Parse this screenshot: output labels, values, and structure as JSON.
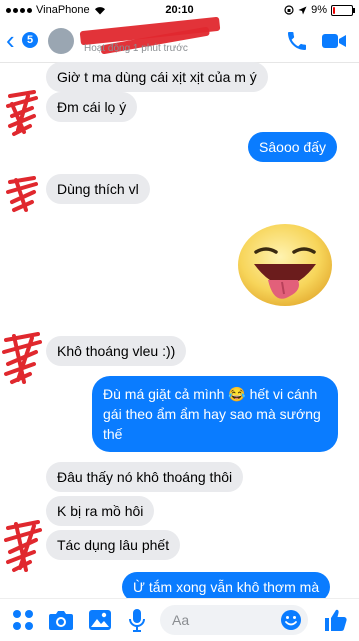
{
  "status_bar": {
    "carrier": "VinaPhone",
    "time": "20:10",
    "battery": "9%",
    "battery_level": 0.09
  },
  "header": {
    "back_count": "5",
    "status": "Hoạt động 1 phút trước"
  },
  "messages": [
    {
      "side": "in",
      "text": "Giờ t ma dùng cái xịt xịt của m ý"
    },
    {
      "side": "in",
      "text": "Đm cái lọ ý"
    },
    {
      "side": "out",
      "text": "Sâooo đấy"
    },
    {
      "side": "in",
      "text": "Dùng thích vl"
    },
    {
      "side": "out",
      "type": "sticker",
      "icon": "tongue-out-smiley-sticker"
    },
    {
      "side": "in",
      "text": "Khô thoáng vleu :))"
    },
    {
      "side": "out",
      "text": "Đù má giặt cả mình 😂 hết vi cánh gái theo ẩm ẩm hay sao mà sướng thế"
    },
    {
      "side": "in",
      "text": "Đâu thấy nó khô thoáng thôi"
    },
    {
      "side": "in",
      "text": "K bị ra mồ hôi"
    },
    {
      "side": "in",
      "text": "Tác dụng lâu phết"
    },
    {
      "side": "out",
      "text": "Ừ tắm xong vẫn khô thơm mà"
    }
  ],
  "composer": {
    "placeholder": "Aa"
  },
  "colors": {
    "accent": "#0a7cff",
    "incoming": "#e9eaed",
    "redaction": "#e0282e"
  }
}
